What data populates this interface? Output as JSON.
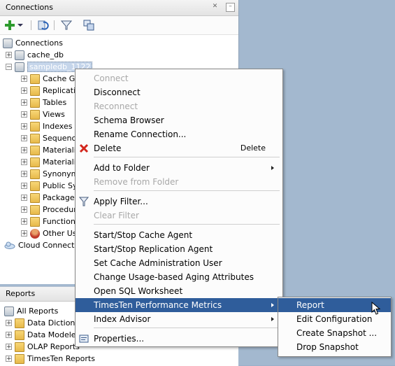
{
  "connections_panel": {
    "title": "Connections",
    "tree": {
      "root": "Connections",
      "conn1": "cache_db",
      "conn2": "sampledb_1122",
      "children": [
        "Cache Gr",
        "Replicatio",
        "Tables",
        "Views",
        "Indexes",
        "Sequenc",
        "Materializ",
        "Materializ",
        "Synonym",
        "Public Sy",
        "Packages",
        "Procedur",
        "Function",
        "Other Us"
      ],
      "cloud": "Cloud Connection"
    }
  },
  "reports_panel": {
    "title": "Reports",
    "items": [
      "All Reports",
      "Data Dictiona",
      "Data Modeler",
      "OLAP Reports",
      "TimesTen Reports"
    ]
  },
  "context_menu": {
    "items": [
      {
        "label": "Connect",
        "enabled": false
      },
      {
        "label": "Disconnect",
        "enabled": true
      },
      {
        "label": "Reconnect",
        "enabled": false
      },
      {
        "label": "Schema Browser",
        "enabled": true
      },
      {
        "label": "Rename Connection...",
        "enabled": true
      },
      {
        "label": "Delete",
        "enabled": true,
        "shortcut": "Delete",
        "icon": "delete-icon"
      },
      {
        "label": "Add to Folder",
        "enabled": true,
        "submenu": true
      },
      {
        "label": "Remove from Folder",
        "enabled": false
      },
      {
        "label": "Apply Filter...",
        "enabled": true,
        "icon": "filter-icon"
      },
      {
        "label": "Clear Filter",
        "enabled": false
      },
      {
        "label": "Start/Stop Cache Agent",
        "enabled": true
      },
      {
        "label": "Start/Stop Replication Agent",
        "enabled": true
      },
      {
        "label": "Set Cache Administration User",
        "enabled": true
      },
      {
        "label": "Change Usage-based Aging Attributes",
        "enabled": true
      },
      {
        "label": "Open SQL Worksheet",
        "enabled": true
      },
      {
        "label": "TimesTen Performance Metrics",
        "enabled": true,
        "submenu": true,
        "highlighted": true
      },
      {
        "label": "Index Advisor",
        "enabled": true,
        "submenu": true
      },
      {
        "label": "Properties...",
        "enabled": true,
        "icon": "properties-icon"
      }
    ]
  },
  "submenu": {
    "items": [
      "Report",
      "Edit Configuration",
      "Create Snapshot ...",
      "Drop Snapshot"
    ],
    "highlighted": "Report"
  },
  "colors": {
    "highlight": "#2f5d9b",
    "disabled_text": "#a8a8a8",
    "desktop": "#a3b8cf"
  }
}
